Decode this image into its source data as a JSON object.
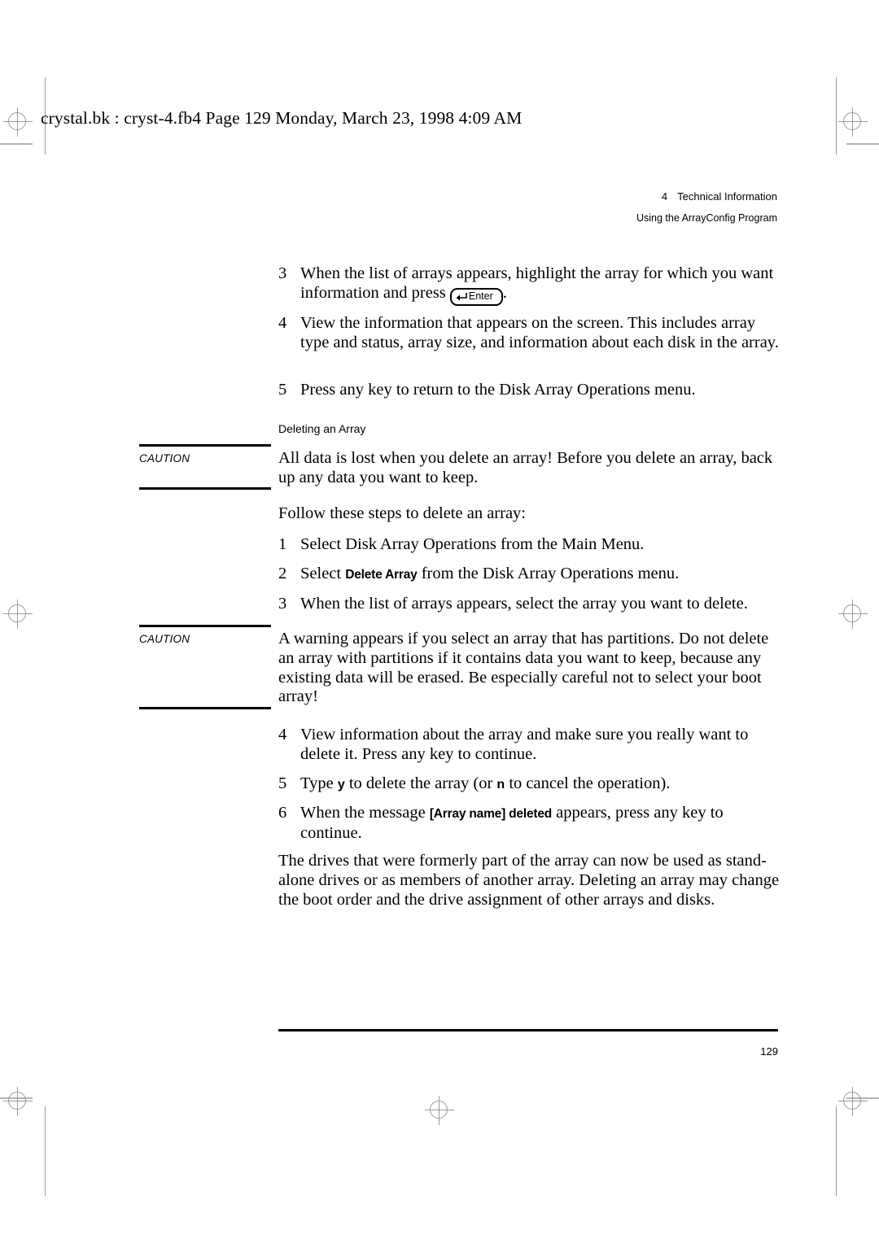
{
  "banner": "crystal.bk : cryst-4.fb4  Page 129  Monday, March 23, 1998  4:09 AM",
  "running_head": {
    "chapter_number": "4",
    "chapter_title": "Technical Information",
    "section_title": "Using the ArrayConfig Program"
  },
  "content": {
    "view_steps": [
      {
        "number": "3",
        "text_before": "When the list of arrays appears, highlight the array for which you want information and press",
        "keycap": {
          "symbol": "◀─┘",
          "label": "Enter"
        },
        "text_after": "."
      },
      {
        "number": "4",
        "text": "View the information that appears on the screen. This includes array type and status, array size, and information about each disk in the array."
      },
      {
        "number": "5",
        "text": "Press any key to return to the Disk Array Operations menu."
      }
    ],
    "subheading": "Deleting an Array",
    "caution_1": {
      "label": "CAUTION",
      "text": "All data is lost when you delete an array! Before you delete an array, back up any data you want to keep."
    },
    "intro_paragraph": "Follow these steps to delete an array:",
    "delete_steps_a": [
      {
        "number": "1",
        "text": "Select Disk Array Operations from the Main Menu."
      },
      {
        "number": "2",
        "text_before": "Select",
        "ui_string": "Delete Array",
        "text_after": "from the Disk Array Operations menu."
      },
      {
        "number": "3",
        "text": "When the list of arrays appears, select the array you want to delete."
      }
    ],
    "caution_2": {
      "label": "CAUTION",
      "text": "A warning appears if you select an array that has partitions. Do not delete an array with partitions if it contains data you want to keep, because any existing data will be erased. Be especially careful not to select your boot array!"
    },
    "delete_steps_b": [
      {
        "number": "4",
        "text": "View information about the array and make sure you really want to delete it. Press any key to continue."
      },
      {
        "number": "5",
        "text_before": "Type",
        "key_yes": "y",
        "text_middle": "to delete the array (or",
        "key_no": "n",
        "text_after": "to cancel the operation)."
      },
      {
        "number": "6",
        "text_before": "When the message",
        "ui_string": "[Array name] deleted",
        "text_after": "appears, press any key to continue."
      }
    ],
    "closing_paragraph": "The drives that were formerly part of the array can now be used as stand-alone drives or as members of another array. Deleting an array may change the boot order and the drive assignment of other arrays and disks."
  },
  "footer": {
    "page_number": "129"
  }
}
